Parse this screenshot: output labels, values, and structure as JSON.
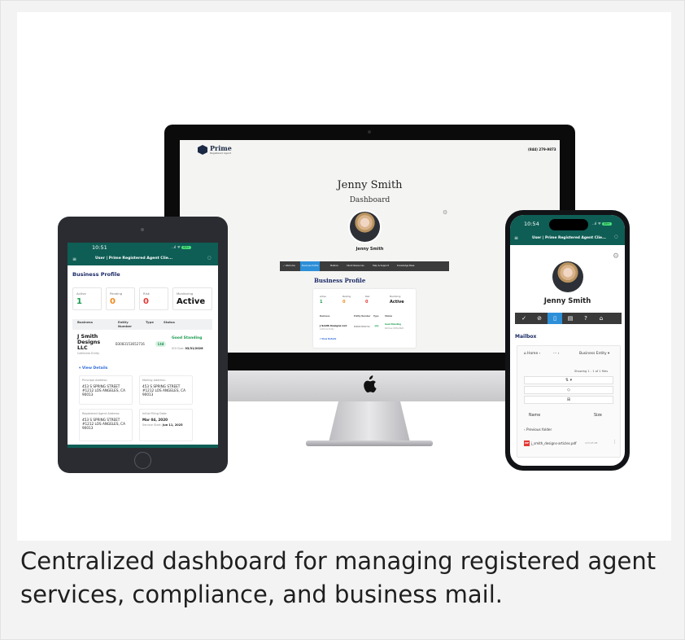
{
  "caption": "Centralized dashboard for managing registered agent services, compliance, and business mail.",
  "imac": {
    "logo_name": "Prime",
    "logo_sub": "Registered Agent",
    "phone": "(844) 279-9873",
    "user_name": "Jenny Smith",
    "page_heading": "Dashboard",
    "avatar_caption": "Jenny Smith",
    "nav": [
      "✓ Welcome",
      "Business Profile",
      "Mailbox",
      "Client Resources",
      "Help & Support",
      "Knowledge Base"
    ],
    "section_title": "Business Profile",
    "panel": {
      "labels": [
        "Active",
        "Pending",
        "Risk",
        "Monitoring"
      ],
      "values": [
        "1",
        "0",
        "0",
        "Active"
      ],
      "cols": [
        "Business",
        "Entity Number",
        "Type",
        "Status"
      ],
      "row_name": "J Smith Designs LLC",
      "row_sub": "California Entity",
      "row_num": "B3083153652716",
      "row_pill": "Ltd",
      "row_status": "Good Standing",
      "row_due": "SOI Due: 03/31/2026",
      "view_details": "▾ View Details"
    }
  },
  "tablet": {
    "time": "10:51",
    "status_right": "..ıl ᯤ",
    "battery": "83+",
    "menu_icon": "≡",
    "title": "User | Prime Registered Agent Clie...",
    "chat_icon": "◌",
    "section_title": "Business Profile",
    "stats": [
      {
        "label": "Active",
        "value": "1",
        "color": "#1a9b4f"
      },
      {
        "label": "Pending",
        "value": "0",
        "color": "#f08a1c"
      },
      {
        "label": "Risk",
        "value": "0",
        "color": "#e53935"
      },
      {
        "label": "Monitoring",
        "value": "Active",
        "color": "#111111"
      }
    ],
    "headers": [
      "Business",
      "Entity Number",
      "Type",
      "Status"
    ],
    "row": {
      "name": "J Smith Designs LLC",
      "sub": "California Entity",
      "number": "B3083153652716",
      "pill": "Ltd",
      "status": "Good Standing",
      "due_label": "SOI Due:",
      "due_date": "03/31/2026"
    },
    "view_details": "▾ View Details",
    "cards": [
      {
        "label": "Principal Address:",
        "value": "453 S SPRING STREET #1212 LOS ANGELES, CA 90013"
      },
      {
        "label": "Mailing Address:",
        "value": "453 S SPRING STREET #1212 LOS ANGELES, CA 90013"
      },
      {
        "label": "Registered Agent Address:",
        "value": "453 S SPRING STREET #1212 LOS ANGELES, CA 90013"
      },
      {
        "label": "Initial Filing Date:",
        "value": "Mar 04, 2020",
        "extra_label": "Service Start:",
        "extra_value": "Jun 11, 2025"
      }
    ]
  },
  "phone": {
    "time": "10:54",
    "status_right": "..ıl ᯤ",
    "battery": "89+",
    "menu_icon": "≡",
    "title": "User | Prime Registered Agent Clie...",
    "chat_icon": "◌",
    "user_name": "Jenny Smith",
    "nav_icons": [
      "✓",
      "⊘",
      "▯",
      "▤",
      "?",
      "⌂"
    ],
    "mailbox_title": "Mailbox",
    "crumbs": [
      "⌂ Home  ›",
      "···  ›",
      "Business Entity  ▾"
    ],
    "showing": "Showing 1 - 1 of 1 files",
    "controls": [
      "⇅ ▾",
      "◇",
      "⊞"
    ],
    "col_name": "Name",
    "col_size": "Size",
    "previous_folder": "‹   Previous folder",
    "file_icon": "PDF",
    "file_name": "j_smith_designs-articles.pdf",
    "file_size": "123.95 KB",
    "kebab": "⋮"
  },
  "colors": {
    "brand_teal": "#0e5e55",
    "navy": "#1b2a66",
    "accent_blue": "#2d8fd8",
    "good_green": "#1a9b4f",
    "pending_orange": "#f08a1c",
    "risk_red": "#e53935"
  }
}
